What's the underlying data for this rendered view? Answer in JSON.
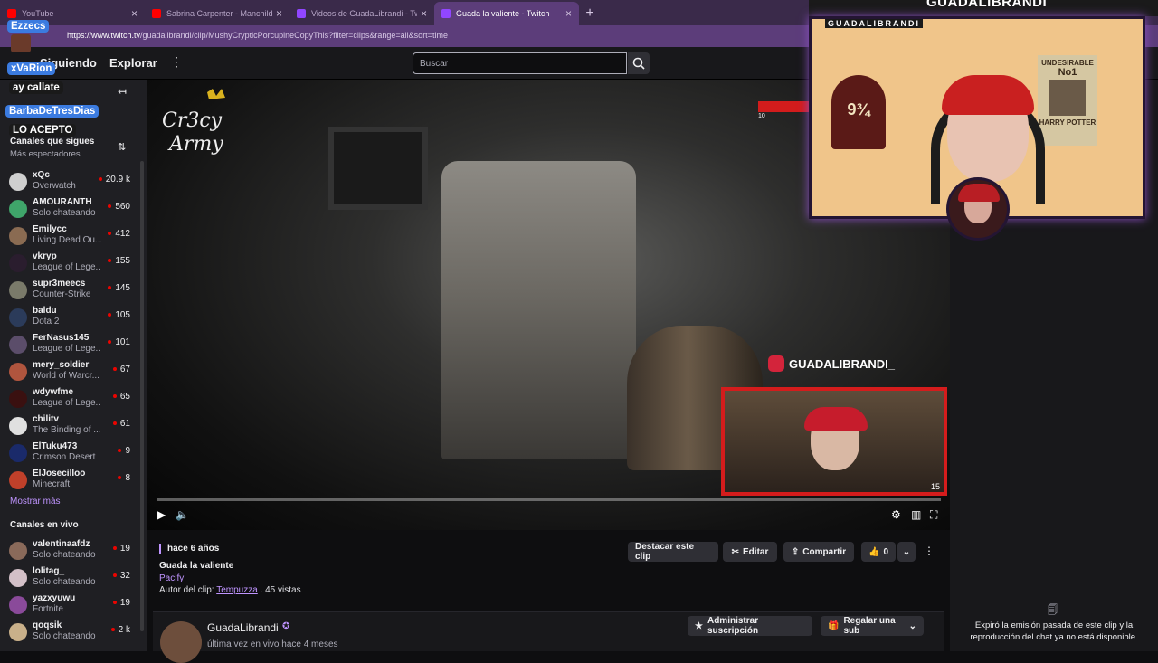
{
  "browser": {
    "tabs": [
      {
        "title": "YouTube",
        "color": "#ff0000",
        "active": false
      },
      {
        "title": "Sabrina Carpenter - Manchild (Offi",
        "color": "#ff0000",
        "active": false
      },
      {
        "title": "Videos de GuadaLibrandi - Twitch",
        "color": "#9146ff",
        "active": false
      },
      {
        "title": "Guada la valiente - Twitch",
        "color": "#9146ff",
        "active": true
      }
    ],
    "new_tab": "+",
    "url_host": "https://www.twitch.tv",
    "url_path": "/guadalibrandi/clip/MushyCrypticPorcupineCopyThis?filter=clips&range=all&sort=time"
  },
  "overlay_chat": {
    "user1": "Ezzecs",
    "user2": "xVaRion",
    "msg1": "ay callate",
    "user3": "BarbaDeTresDias",
    "msg2": "LO ACEPTO",
    "nav_partial": "Siguiendo"
  },
  "topnav": {
    "explore": "Explorar",
    "more": "⋮",
    "search_placeholder": "Buscar"
  },
  "sidebar": {
    "followed_title": "Canales que sigues",
    "followed_sort": "Más espectadores",
    "followed": [
      {
        "name": "xQc",
        "game": "Overwatch",
        "viewers": "20.9 k",
        "color": "#cfcfcf"
      },
      {
        "name": "AMOURANTH",
        "game": "Solo chateando",
        "viewers": "560",
        "color": "#3fa56a"
      },
      {
        "name": "Emilycc",
        "game": "Living Dead Ou...",
        "viewers": "412",
        "color": "#8a6b52"
      },
      {
        "name": "vkryp",
        "game": "League of Lege...",
        "viewers": "155",
        "color": "#2a1d2e"
      },
      {
        "name": "supr3meecs",
        "game": "Counter-Strike",
        "viewers": "145",
        "color": "#7a7a6a"
      },
      {
        "name": "baldu",
        "game": "Dota 2",
        "viewers": "105",
        "color": "#2b3b5a"
      },
      {
        "name": "FerNasus145",
        "game": "League of Lege...",
        "viewers": "101",
        "color": "#5b4d6a"
      },
      {
        "name": "mery_soldier",
        "game": "World of Warcr...",
        "viewers": "67",
        "color": "#b0553e"
      },
      {
        "name": "wdywfme",
        "game": "League of Lege...",
        "viewers": "65",
        "color": "#3a1010"
      },
      {
        "name": "chilitv",
        "game": "The Binding of ...",
        "viewers": "61",
        "color": "#e0e0e0"
      },
      {
        "name": "ElTuku473",
        "game": "Crimson Desert",
        "viewers": "9",
        "color": "#1a2a6a"
      },
      {
        "name": "ElJosecilloo",
        "game": "Minecraft",
        "viewers": "8",
        "color": "#c0402a"
      }
    ],
    "show_more": "Mostrar más",
    "live_title": "Canales en vivo",
    "live": [
      {
        "name": "valentinaafdz",
        "game": "Solo chateando",
        "viewers": "19",
        "color": "#8a6a5a"
      },
      {
        "name": "lolitag_",
        "game": "Solo chateando",
        "viewers": "32",
        "color": "#d3c0c8"
      },
      {
        "name": "yazxyuwu",
        "game": "Fortnite",
        "viewers": "19",
        "color": "#8a4a9a"
      },
      {
        "name": "qoqsik",
        "game": "Solo chateando",
        "viewers": "2 k",
        "color": "#c9b08a"
      }
    ]
  },
  "video": {
    "overlay_handle": "GUADALIBRANDI_",
    "corner_number": "15",
    "timer_text": "10"
  },
  "clip": {
    "age": "hace 6 años",
    "title": "Guada la valiente",
    "game": "Pacify",
    "author_label": "Autor del clip:",
    "author": "Tempuzza",
    "views": ". 45 vistas",
    "actions": {
      "highlight": "Destacar este clip",
      "edit": "Editar",
      "share": "Compartir",
      "likes": "0"
    }
  },
  "channel": {
    "name": "GuadaLibrandi",
    "status": "última vez en vivo hace 4 meses",
    "manage_sub": "Administrar suscripción",
    "gift_sub": "Regalar una sub"
  },
  "chat_panel": {
    "expired": "Expiró la emisión pasada de este clip y la reproducción del chat ya no está disponible."
  },
  "webcam": {
    "top_name": "GUADALIBRANDI",
    "label": "GUADALIBRANDI",
    "platform": "9¾",
    "poster_top": "UNDESIRABLE",
    "poster_num": "No1",
    "poster_name": "HARRY POTTER"
  }
}
